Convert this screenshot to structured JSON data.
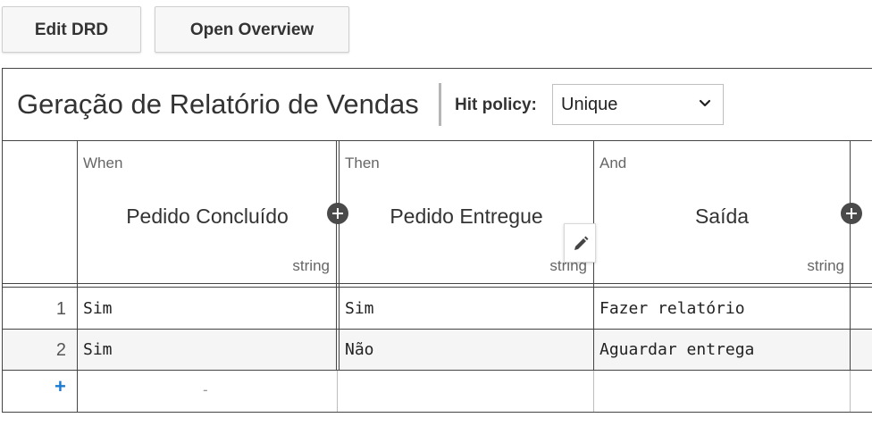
{
  "toolbar": {
    "edit_drd_label": "Edit DRD",
    "open_overview_label": "Open Overview"
  },
  "table": {
    "title": "Geração de Relatório de Vendas",
    "hit_policy_label": "Hit policy:",
    "hit_policy_value": "Unique",
    "columns": [
      {
        "kind": "When",
        "name": "Pedido Concluído",
        "type": "string"
      },
      {
        "kind": "Then",
        "name": "Pedido Entregue",
        "type": "string"
      },
      {
        "kind": "And",
        "name": "Saída",
        "type": "string"
      }
    ],
    "rows": [
      {
        "index": "1",
        "cells": [
          "Sim",
          "Sim",
          "Fazer relatório"
        ]
      },
      {
        "index": "2",
        "cells": [
          "Sim",
          "Não",
          "Aguardar entrega"
        ]
      }
    ],
    "add_row_symbol": "+",
    "empty_placeholder": "-"
  },
  "icons": {
    "add_column": "plus-circle-icon",
    "edit": "pencil-icon",
    "select": "chevron-down-icon"
  },
  "colors": {
    "accent": "#1a7bd0",
    "border": "#444444",
    "row_alt": "#f5f5f5"
  }
}
